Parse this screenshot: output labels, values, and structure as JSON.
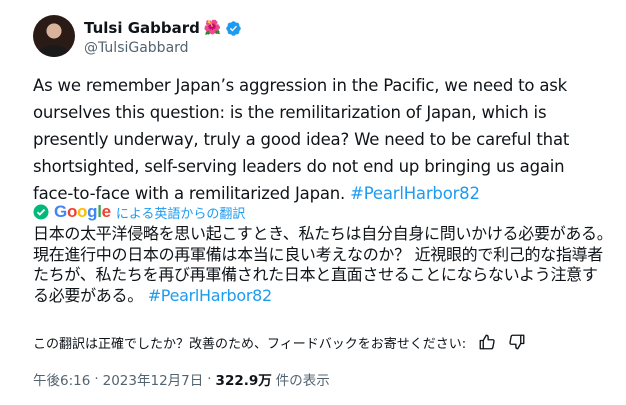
{
  "author": {
    "name": "Tulsi Gabbard",
    "flower_emoji": "🌺",
    "handle": "@TulsiGabbard"
  },
  "tweet": {
    "text_before_tag": "As we remember Japan’s aggression in the Pacific, we need to ask ourselves this question: is the remilitarization of Japan, which is presently underway, truly a good idea? We need to be careful that shortsighted, self-serving leaders do not end up bringing us again face-to-face with a remilitarized Japan. ",
    "hashtag": "#PearlHarbor82"
  },
  "translation": {
    "provider_g": "G",
    "provider_o1": "o",
    "provider_o2": "o",
    "provider_g2": "g",
    "provider_l": "l",
    "provider_e": "e",
    "label": "による英語からの翻訳",
    "text_before_tag": "日本の太平洋侵略を思い起こすとき、私たちは自分自身に問いかける必要がある。現在進行中の日本の再軍備は本当に良い考えなのか？ 近視眼的で利己的な指導者たちが、私たちを再び再軍備された日本と直面させることにならないよう注意する必要がある。 ",
    "hashtag": "#PearlHarbor82",
    "feedback_prompt": "この翻訳は正確でしたか？改善のため、フィードバックをお寄せください:"
  },
  "meta": {
    "time": "午後6:16",
    "separator": "·",
    "date": "2023年12月7日",
    "separator2": "·",
    "views_count": "322.9万",
    "views_label": "件の表示"
  },
  "colors": {
    "link": "#1d9bf0",
    "verified": "#1d9bf0",
    "check": "#00ba7c"
  }
}
